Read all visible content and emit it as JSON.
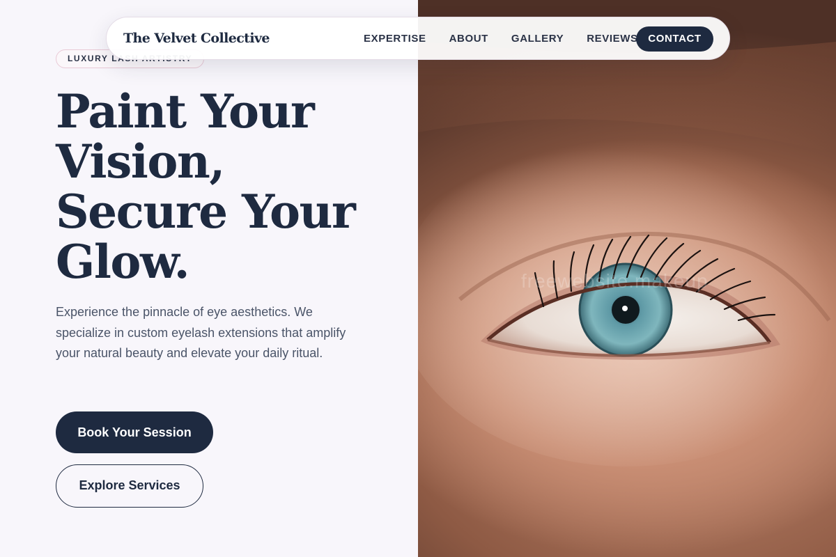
{
  "nav": {
    "brand": "The Velvet Collective",
    "links": [
      "EXPERTISE",
      "ABOUT",
      "GALLERY",
      "REVIEWS"
    ],
    "cta": "CONTACT"
  },
  "hero": {
    "eyebrow": "LUXURY LASH ARTISTRY",
    "headline_lines": [
      "Paint Your",
      "Vision,",
      "Secure Your",
      "Glow."
    ],
    "lead": "Experience the pinnacle of eye aesthetics. We specialize in custom eyelash extensions that amplify your natural beauty and elevate your daily ritual.",
    "primary_button": "Book Your Session",
    "secondary_button": "Explore Services"
  },
  "photo": {
    "watermark": "freewebsite.makeup"
  },
  "colors": {
    "navy": "#1e2a40",
    "background": "#f8f6fb",
    "badge_border": "#e9c9d6",
    "body_text": "#4a5468"
  }
}
